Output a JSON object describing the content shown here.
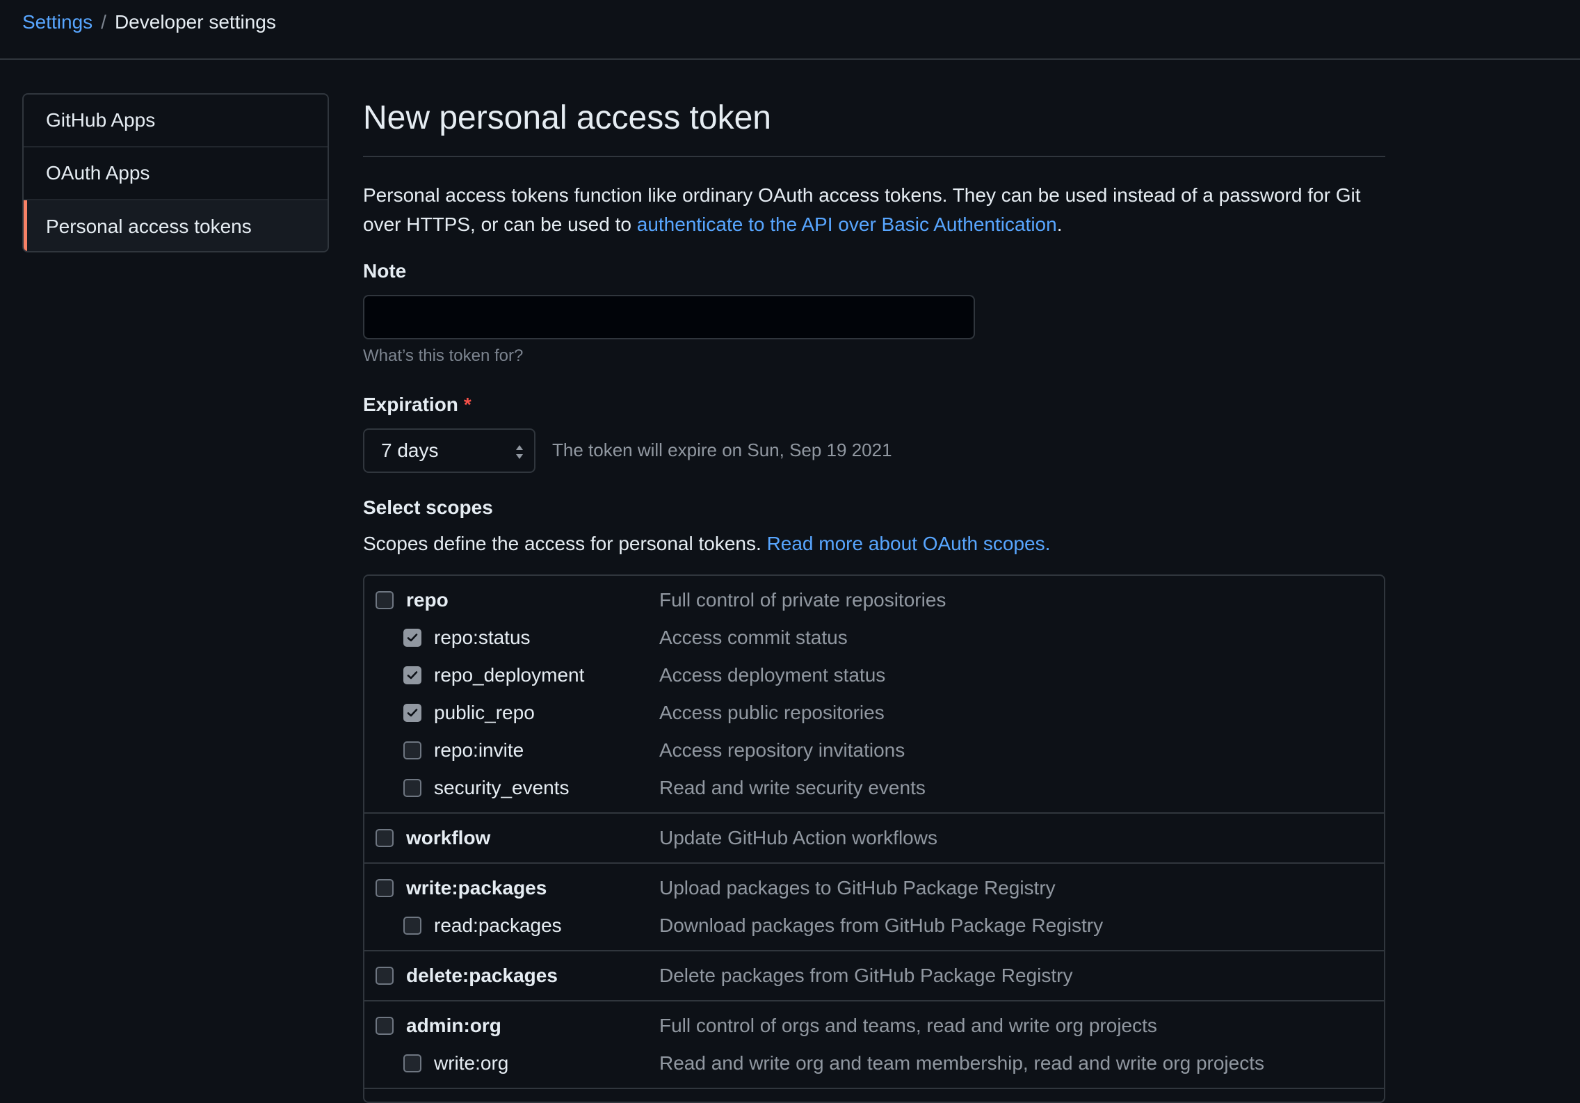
{
  "breadcrumb": {
    "root": "Settings",
    "separator": "/",
    "current": "Developer settings"
  },
  "sidebar": {
    "items": [
      {
        "label": "GitHub Apps"
      },
      {
        "label": "OAuth Apps"
      },
      {
        "label": "Personal access tokens",
        "active": true
      }
    ]
  },
  "page": {
    "title": "New personal access token",
    "intro_text": "Personal access tokens function like ordinary OAuth access tokens. They can be used instead of a password for Git over HTTPS, or can be used to ",
    "intro_link": "authenticate to the API over Basic Authentication",
    "intro_end": "."
  },
  "note": {
    "label": "Note",
    "value": "",
    "hint": "What’s this token for?"
  },
  "expiration": {
    "label": "Expiration",
    "required_mark": "*",
    "selected": "7 days",
    "expires_text": "The token will expire on Sun, Sep 19 2021"
  },
  "scopes": {
    "label": "Select scopes",
    "desc_text": "Scopes define the access for personal tokens. ",
    "desc_link": "Read more about OAuth scopes.",
    "groups": [
      {
        "name": "repo",
        "desc": "Full control of private repositories",
        "checked": false,
        "children": [
          {
            "name": "repo:status",
            "desc": "Access commit status",
            "checked": true
          },
          {
            "name": "repo_deployment",
            "desc": "Access deployment status",
            "checked": true
          },
          {
            "name": "public_repo",
            "desc": "Access public repositories",
            "checked": true
          },
          {
            "name": "repo:invite",
            "desc": "Access repository invitations",
            "checked": false
          },
          {
            "name": "security_events",
            "desc": "Read and write security events",
            "checked": false
          }
        ]
      },
      {
        "name": "workflow",
        "desc": "Update GitHub Action workflows",
        "checked": false,
        "children": []
      },
      {
        "name": "write:packages",
        "desc": "Upload packages to GitHub Package Registry",
        "checked": false,
        "children": [
          {
            "name": "read:packages",
            "desc": "Download packages from GitHub Package Registry",
            "checked": false
          }
        ]
      },
      {
        "name": "delete:packages",
        "desc": "Delete packages from GitHub Package Registry",
        "checked": false,
        "children": []
      },
      {
        "name": "admin:org",
        "desc": "Full control of orgs and teams, read and write org projects",
        "checked": false,
        "children": [
          {
            "name": "write:org",
            "desc": "Read and write org and team membership, read and write org projects",
            "checked": false
          }
        ]
      }
    ]
  },
  "colors": {
    "background": "#0d1117",
    "link": "#58a6ff",
    "active_indicator": "#f78166",
    "required": "#f85149"
  }
}
